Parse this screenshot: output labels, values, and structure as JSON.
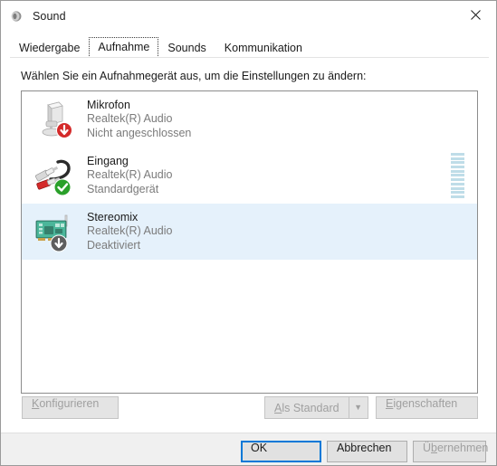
{
  "window": {
    "title": "Sound",
    "icon": "speaker-icon",
    "close_label": "✕"
  },
  "tabs": [
    {
      "label": "Wiedergabe",
      "selected": false
    },
    {
      "label": "Aufnahme",
      "selected": true
    },
    {
      "label": "Sounds",
      "selected": false
    },
    {
      "label": "Kommunikation",
      "selected": false
    }
  ],
  "panel": {
    "prompt": "Wählen Sie ein Aufnahmegerät aus, um die Einstellungen zu ändern:"
  },
  "devices": [
    {
      "name": "Mikrofon",
      "driver": "Realtek(R) Audio",
      "status": "Nicht angeschlossen",
      "icon": "microphone-icon",
      "badge": "red-down-arrow-badge",
      "selected": false,
      "meter": false
    },
    {
      "name": "Eingang",
      "driver": "Realtek(R) Audio",
      "status": "Standardgerät",
      "icon": "rca-cable-icon",
      "badge": "green-check-badge",
      "selected": false,
      "meter": true
    },
    {
      "name": "Stereomix",
      "driver": "Realtek(R) Audio",
      "status": "Deaktiviert",
      "icon": "sound-card-icon",
      "badge": "gray-down-arrow-badge",
      "selected": true,
      "meter": false
    }
  ],
  "buttons": {
    "configure": {
      "prefix": "",
      "accesskey": "K",
      "suffix": "onfigurieren",
      "disabled": true
    },
    "set_default": {
      "prefix": "",
      "accesskey": "A",
      "suffix": "ls Standard",
      "disabled": true
    },
    "set_default_arrow": "▼",
    "properties": {
      "prefix": "",
      "accesskey": "E",
      "suffix": "igenschaften",
      "disabled": true
    },
    "ok": {
      "label": "OK",
      "disabled": false
    },
    "cancel": {
      "label": "Abbrechen",
      "disabled": false
    },
    "apply": {
      "prefix": "Ü",
      "accesskey": "b",
      "suffix": "ernehmen",
      "disabled": true
    }
  },
  "colors": {
    "selection": "#e5f1fb",
    "accent": "#0078d7",
    "meter": "#bfdde8",
    "status_ok": "#2aa02a",
    "status_error": "#d42a2a"
  },
  "meter_segments": 11
}
